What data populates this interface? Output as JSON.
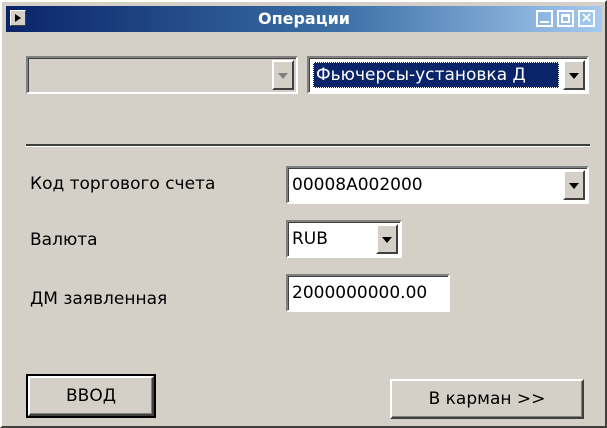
{
  "window": {
    "title": "Операции"
  },
  "top_row": {
    "left_combo_value": "",
    "right_combo_value": "Фьючерсы-установка Д"
  },
  "form": {
    "account_label": "Код торгового счета",
    "account_value": "00008A002000",
    "currency_label": "Валюта",
    "currency_value": "RUB",
    "dm_label": "ДМ заявленная",
    "dm_value": "2000000000.00"
  },
  "buttons": {
    "enter_label": "ВВОД",
    "pocket_label": "В карман >>"
  },
  "colors": {
    "titlebar_start": "#0a246a",
    "titlebar_end": "#a6caf0",
    "face": "#d4d0c8",
    "selection": "#0a246a"
  }
}
